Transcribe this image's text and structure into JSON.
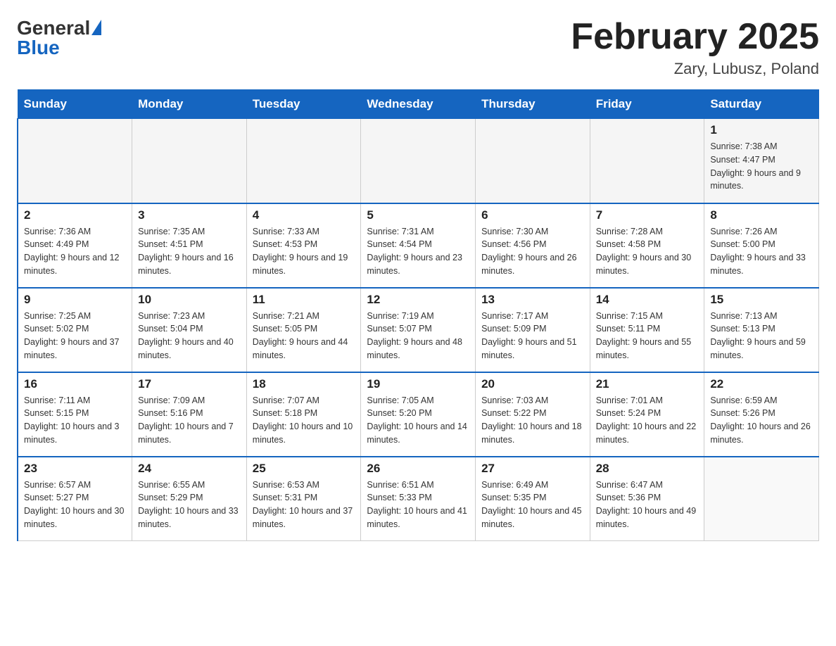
{
  "header": {
    "logo_general": "General",
    "logo_blue": "Blue",
    "calendar_title": "February 2025",
    "calendar_subtitle": "Zary, Lubusz, Poland"
  },
  "weekdays": [
    "Sunday",
    "Monday",
    "Tuesday",
    "Wednesday",
    "Thursday",
    "Friday",
    "Saturday"
  ],
  "weeks": [
    [
      {
        "day": "",
        "info": ""
      },
      {
        "day": "",
        "info": ""
      },
      {
        "day": "",
        "info": ""
      },
      {
        "day": "",
        "info": ""
      },
      {
        "day": "",
        "info": ""
      },
      {
        "day": "",
        "info": ""
      },
      {
        "day": "1",
        "info": "Sunrise: 7:38 AM\nSunset: 4:47 PM\nDaylight: 9 hours and 9 minutes."
      }
    ],
    [
      {
        "day": "2",
        "info": "Sunrise: 7:36 AM\nSunset: 4:49 PM\nDaylight: 9 hours and 12 minutes."
      },
      {
        "day": "3",
        "info": "Sunrise: 7:35 AM\nSunset: 4:51 PM\nDaylight: 9 hours and 16 minutes."
      },
      {
        "day": "4",
        "info": "Sunrise: 7:33 AM\nSunset: 4:53 PM\nDaylight: 9 hours and 19 minutes."
      },
      {
        "day": "5",
        "info": "Sunrise: 7:31 AM\nSunset: 4:54 PM\nDaylight: 9 hours and 23 minutes."
      },
      {
        "day": "6",
        "info": "Sunrise: 7:30 AM\nSunset: 4:56 PM\nDaylight: 9 hours and 26 minutes."
      },
      {
        "day": "7",
        "info": "Sunrise: 7:28 AM\nSunset: 4:58 PM\nDaylight: 9 hours and 30 minutes."
      },
      {
        "day": "8",
        "info": "Sunrise: 7:26 AM\nSunset: 5:00 PM\nDaylight: 9 hours and 33 minutes."
      }
    ],
    [
      {
        "day": "9",
        "info": "Sunrise: 7:25 AM\nSunset: 5:02 PM\nDaylight: 9 hours and 37 minutes."
      },
      {
        "day": "10",
        "info": "Sunrise: 7:23 AM\nSunset: 5:04 PM\nDaylight: 9 hours and 40 minutes."
      },
      {
        "day": "11",
        "info": "Sunrise: 7:21 AM\nSunset: 5:05 PM\nDaylight: 9 hours and 44 minutes."
      },
      {
        "day": "12",
        "info": "Sunrise: 7:19 AM\nSunset: 5:07 PM\nDaylight: 9 hours and 48 minutes."
      },
      {
        "day": "13",
        "info": "Sunrise: 7:17 AM\nSunset: 5:09 PM\nDaylight: 9 hours and 51 minutes."
      },
      {
        "day": "14",
        "info": "Sunrise: 7:15 AM\nSunset: 5:11 PM\nDaylight: 9 hours and 55 minutes."
      },
      {
        "day": "15",
        "info": "Sunrise: 7:13 AM\nSunset: 5:13 PM\nDaylight: 9 hours and 59 minutes."
      }
    ],
    [
      {
        "day": "16",
        "info": "Sunrise: 7:11 AM\nSunset: 5:15 PM\nDaylight: 10 hours and 3 minutes."
      },
      {
        "day": "17",
        "info": "Sunrise: 7:09 AM\nSunset: 5:16 PM\nDaylight: 10 hours and 7 minutes."
      },
      {
        "day": "18",
        "info": "Sunrise: 7:07 AM\nSunset: 5:18 PM\nDaylight: 10 hours and 10 minutes."
      },
      {
        "day": "19",
        "info": "Sunrise: 7:05 AM\nSunset: 5:20 PM\nDaylight: 10 hours and 14 minutes."
      },
      {
        "day": "20",
        "info": "Sunrise: 7:03 AM\nSunset: 5:22 PM\nDaylight: 10 hours and 18 minutes."
      },
      {
        "day": "21",
        "info": "Sunrise: 7:01 AM\nSunset: 5:24 PM\nDaylight: 10 hours and 22 minutes."
      },
      {
        "day": "22",
        "info": "Sunrise: 6:59 AM\nSunset: 5:26 PM\nDaylight: 10 hours and 26 minutes."
      }
    ],
    [
      {
        "day": "23",
        "info": "Sunrise: 6:57 AM\nSunset: 5:27 PM\nDaylight: 10 hours and 30 minutes."
      },
      {
        "day": "24",
        "info": "Sunrise: 6:55 AM\nSunset: 5:29 PM\nDaylight: 10 hours and 33 minutes."
      },
      {
        "day": "25",
        "info": "Sunrise: 6:53 AM\nSunset: 5:31 PM\nDaylight: 10 hours and 37 minutes."
      },
      {
        "day": "26",
        "info": "Sunrise: 6:51 AM\nSunset: 5:33 PM\nDaylight: 10 hours and 41 minutes."
      },
      {
        "day": "27",
        "info": "Sunrise: 6:49 AM\nSunset: 5:35 PM\nDaylight: 10 hours and 45 minutes."
      },
      {
        "day": "28",
        "info": "Sunrise: 6:47 AM\nSunset: 5:36 PM\nDaylight: 10 hours and 49 minutes."
      },
      {
        "day": "",
        "info": ""
      }
    ]
  ]
}
